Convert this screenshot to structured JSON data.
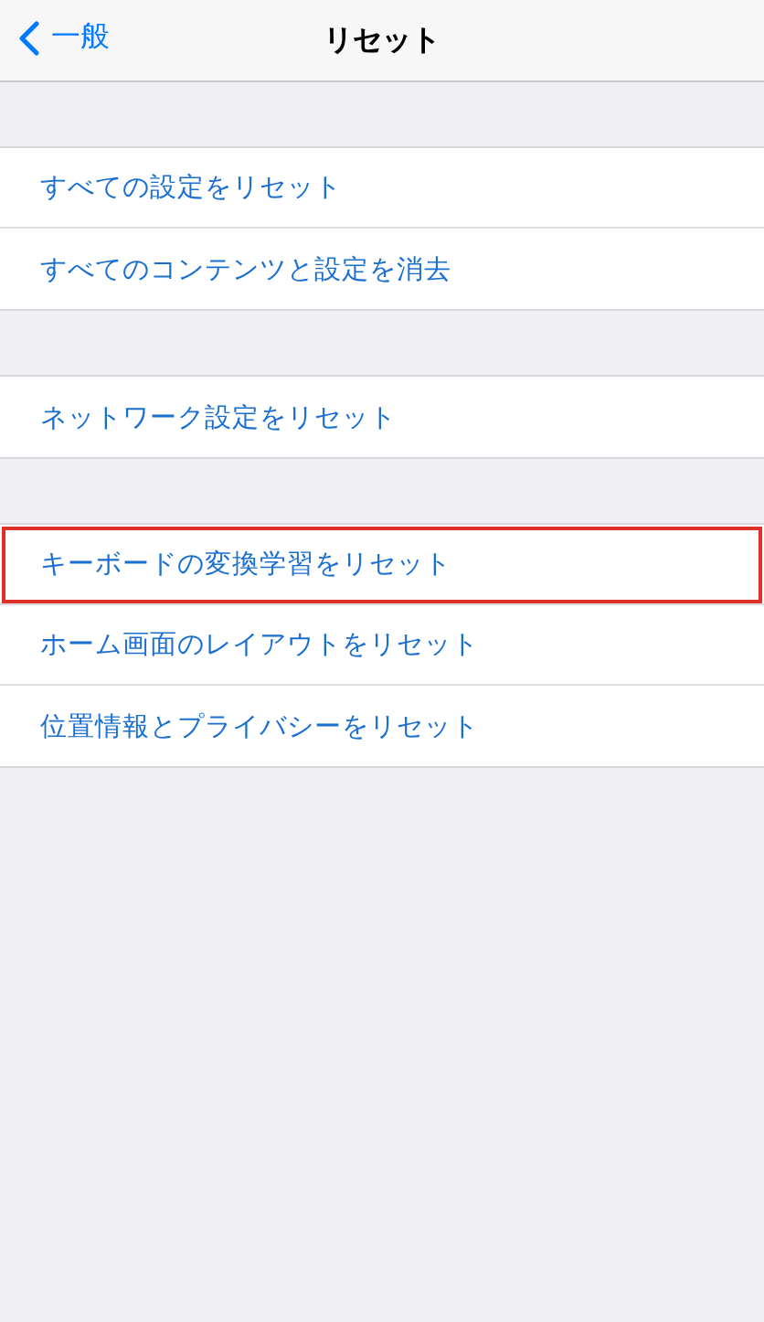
{
  "nav_bar": {
    "back_label": "一般",
    "title": "リセット"
  },
  "groups": [
    {
      "items": [
        {
          "label": "すべての設定をリセット",
          "highlighted": false
        },
        {
          "label": "すべてのコンテンツと設定を消去",
          "highlighted": false
        }
      ]
    },
    {
      "items": [
        {
          "label": "ネットワーク設定をリセット",
          "highlighted": false
        }
      ]
    },
    {
      "items": [
        {
          "label": "キーボードの変換学習をリセット",
          "highlighted": true
        },
        {
          "label": "ホーム画面のレイアウトをリセット",
          "highlighted": false
        },
        {
          "label": "位置情報とプライバシーをリセット",
          "highlighted": false
        }
      ]
    }
  ]
}
